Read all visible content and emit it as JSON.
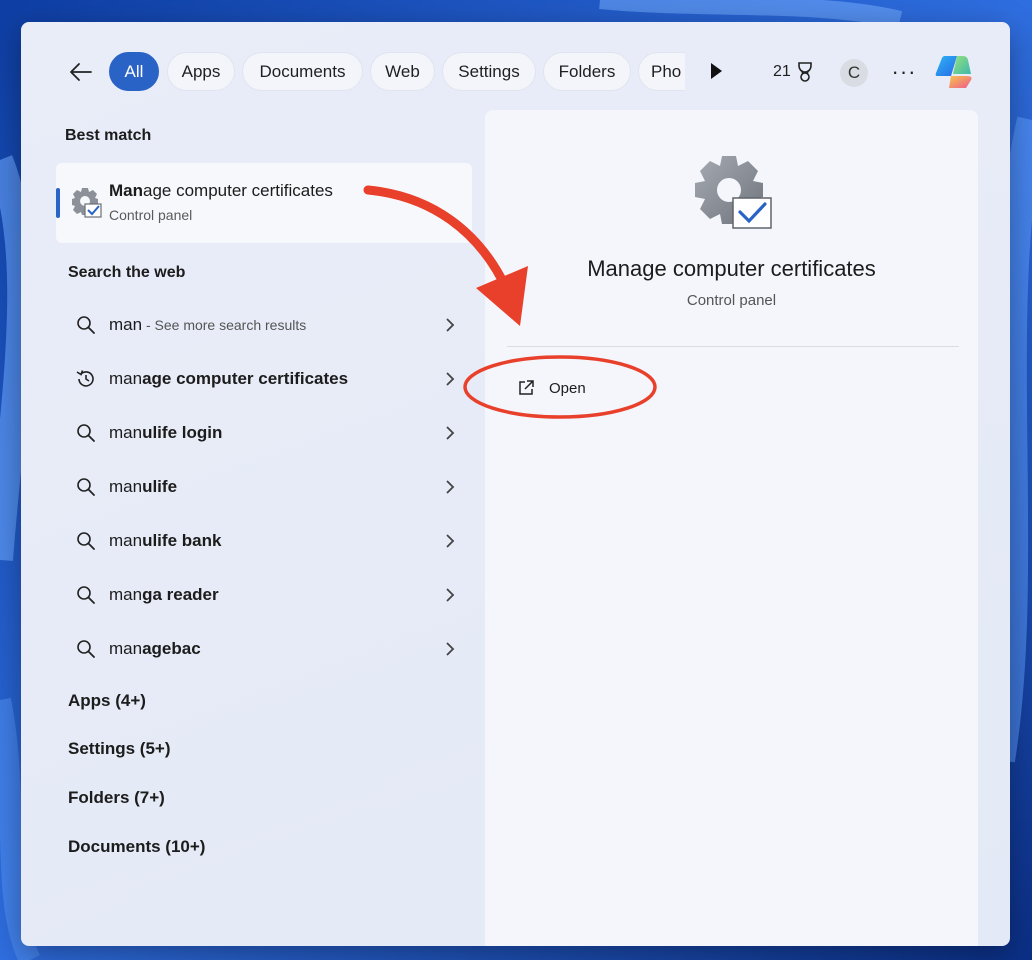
{
  "filters": {
    "tabs": [
      {
        "label": "All",
        "active": true
      },
      {
        "label": "Apps"
      },
      {
        "label": "Documents"
      },
      {
        "label": "Web"
      },
      {
        "label": "Settings"
      },
      {
        "label": "Folders"
      },
      {
        "label": "Pho"
      }
    ],
    "points": "21"
  },
  "user": {
    "initial": "C"
  },
  "more_label": "···",
  "best_match": {
    "section": "Best match",
    "title_bold": "Man",
    "title_rest": "age computer certificates",
    "subtitle": "Control panel"
  },
  "web": {
    "section": "Search the web",
    "items": [
      {
        "icon": "search-icon",
        "prefix": "man",
        "rest": "",
        "hint": " - See more search results"
      },
      {
        "icon": "history-icon",
        "prefix": "man",
        "rest": "age computer certificates",
        "hint": ""
      },
      {
        "icon": "search-icon",
        "prefix": "man",
        "rest": "ulife login",
        "hint": ""
      },
      {
        "icon": "search-icon",
        "prefix": "man",
        "rest": "ulife",
        "hint": ""
      },
      {
        "icon": "search-icon",
        "prefix": "man",
        "rest": "ulife bank",
        "hint": ""
      },
      {
        "icon": "search-icon",
        "prefix": "man",
        "rest": "ga reader",
        "hint": ""
      },
      {
        "icon": "search-icon",
        "prefix": "man",
        "rest": "agebac",
        "hint": ""
      }
    ]
  },
  "categories": [
    "Apps (4+)",
    "Settings (5+)",
    "Folders (7+)",
    "Documents (10+)"
  ],
  "preview": {
    "title": "Manage computer certificates",
    "subtitle": "Control panel",
    "open_label": "Open"
  },
  "colors": {
    "accent": "#2a63c6",
    "annotation": "#e8402a"
  }
}
